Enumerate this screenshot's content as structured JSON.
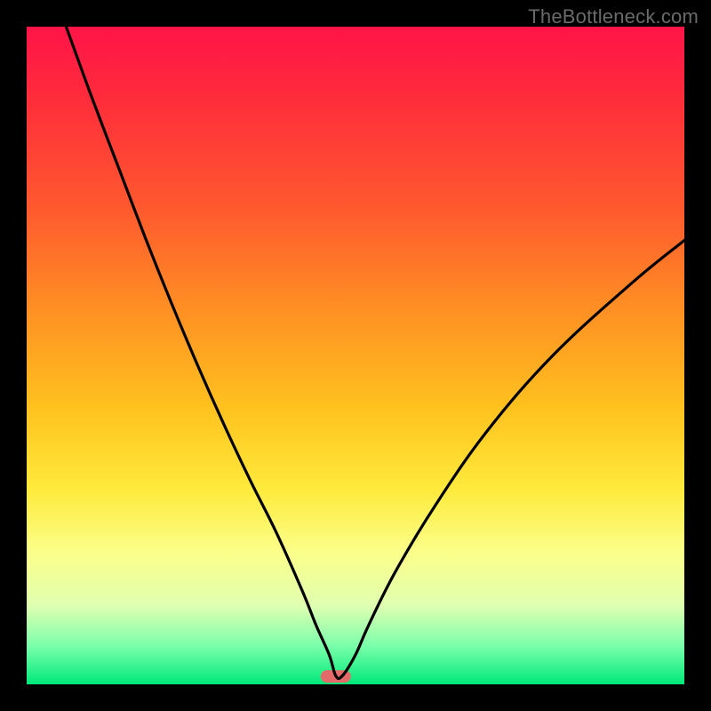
{
  "watermark": "TheBottleneck.com",
  "chart_data": {
    "type": "line",
    "title": "",
    "xlabel": "",
    "ylabel": "",
    "xlim": [
      0,
      100
    ],
    "ylim": [
      0,
      100
    ],
    "grid": false,
    "legend": false,
    "annotations": [
      {
        "kind": "marker",
        "shape": "capsule",
        "x": 47,
        "y": 1.2,
        "color": "#e46a6a"
      }
    ],
    "series": [
      {
        "name": "curve",
        "color": "#000000",
        "x": [
          6,
          10,
          14,
          18,
          22,
          26,
          30,
          34,
          38,
          42,
          44,
          46,
          47,
          48,
          50,
          52,
          56,
          62,
          70,
          80,
          92,
          100
        ],
        "y": [
          100,
          89,
          78.5,
          68,
          58,
          48.5,
          39.5,
          31,
          23,
          14,
          9,
          4.5,
          1.3,
          1.3,
          4.5,
          9,
          17,
          27,
          38.5,
          50,
          61,
          67.5
        ]
      }
    ]
  }
}
